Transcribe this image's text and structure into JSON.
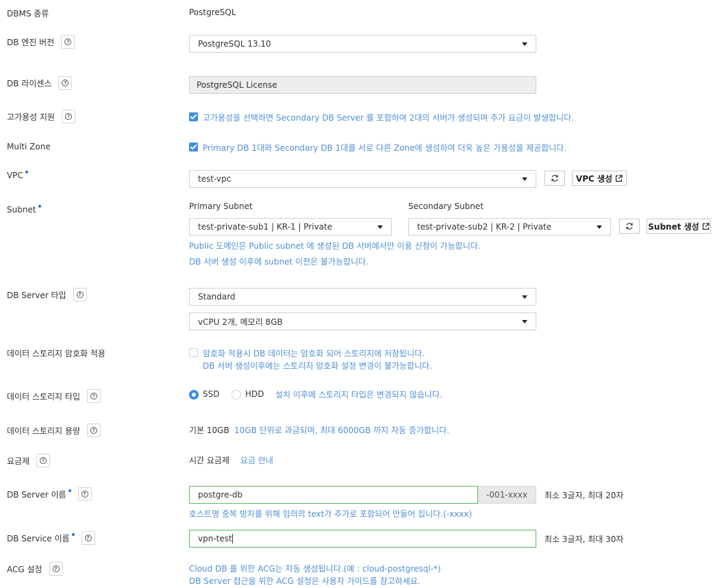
{
  "dbms": {
    "label": "DBMS 종류",
    "value": "PostgreSQL"
  },
  "engine": {
    "label": "DB 엔진 버전",
    "value": "PostgreSQL 13.10"
  },
  "license": {
    "label": "DB 라이센스",
    "value": "PostgreSQL License"
  },
  "ha": {
    "label": "고가용성 지원",
    "checked": true,
    "text": "고가용성을 선택하면 Secondary DB Server 를 포함하여 2대의 서버가 생성되며 추가 요금이 발생합니다."
  },
  "multizone": {
    "label": "Multi Zone",
    "checked": true,
    "text": "Primary DB 1대와 Secondary DB 1대를 서로 다른 Zone에 생성하여 더욱 높은 가용성을 제공합니다."
  },
  "vpc": {
    "label": "VPC",
    "value": "test-vpc",
    "create_label": "VPC 생성"
  },
  "subnet": {
    "label": "Subnet",
    "primary_label": "Primary Subnet",
    "primary_value": "test-private-sub1 | KR-1 | Private",
    "secondary_label": "Secondary Subnet",
    "secondary_value": "test-private-sub2 | KR-2 | Private",
    "create_label": "Subnet 생성",
    "note1": "Public 도메인은 Public subnet 에 생성된 DB 서버에서만 이용 신청이 가능합니다.",
    "note2": "DB 서버 생성 이후에 subnet 이전은 불가능합니다."
  },
  "server_type": {
    "label": "DB Server 타입",
    "type_value": "Standard",
    "spec_value": "vCPU 2개, 메모리 8GB"
  },
  "encryption": {
    "label": "데이터 스토리지 암호화 적용",
    "checked": false,
    "text1": "암호화 적용시 DB 데이터는 암호화 되어 스토리지에 저장됩니다.",
    "text2": "DB 서버 생성이후에는 스토리지 암호화 설정 변경이 불가능합니다."
  },
  "storage_type": {
    "label": "데이터 스토리지 타입",
    "options": [
      "SSD",
      "HDD"
    ],
    "selected": "SSD",
    "note": "설치 이후에 스토리지 타입은 변경되지 않습니다."
  },
  "storage_size": {
    "label": "데이터 스토리지 용량",
    "value": "기본 10GB",
    "note": "10GB 단위로 과금되며, 최대 6000GB 까지 자동 증가합니다."
  },
  "pricing": {
    "label": "요금제",
    "value": "시간 요금제",
    "link": "요금 안내"
  },
  "server_name": {
    "label": "DB Server 이름",
    "value": "postgre-db",
    "suffix": "-001-xxxx",
    "limit": "최소 3글자, 최대 20자",
    "note": "호스트명 중복 방지를 위해 임의의 text가 추가로 포함되어 만들어 집니다.(-xxxx)"
  },
  "service_name": {
    "label": "DB Service 이름",
    "value": "vpn-test",
    "limit": "최소 3글자, 최대 30자"
  },
  "acg": {
    "label": "ACG 설정",
    "text1": "Cloud DB 를 위한 ACG는 자동 생성됩니다.(예 : cloud-postgresql-*)",
    "text2": "DB Server 접근을 위한 ACG 설정은 사용자 가이드를 참고하세요."
  },
  "colors": {
    "accent": "#3d8de0",
    "note_text": "#4f8fd6",
    "input_valid_border": "#5cb85c"
  }
}
